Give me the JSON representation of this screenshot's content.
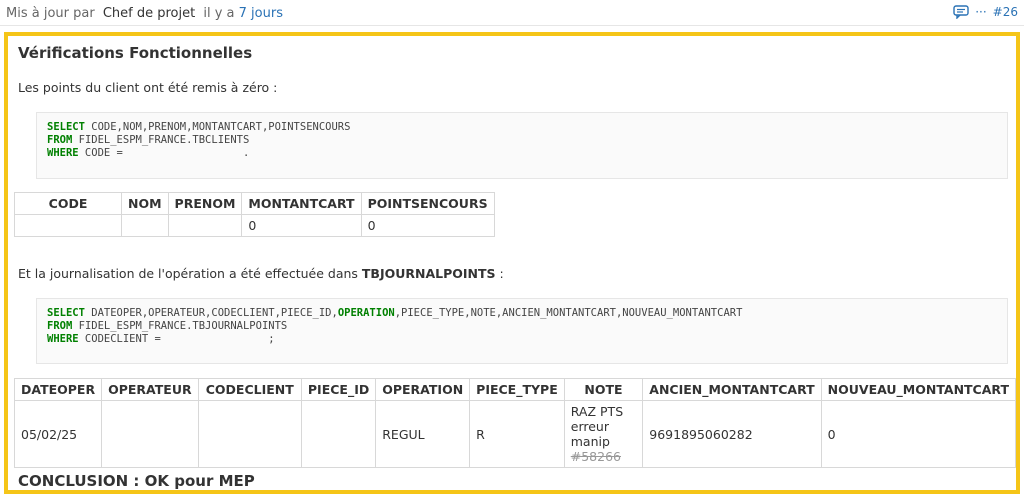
{
  "header": {
    "updated_by_label": "Mis à jour par",
    "author": "Chef de projet",
    "ago_prefix": "il y a",
    "ago_link": "7 jours",
    "more": "···",
    "note_number": "#26",
    "icons": [
      "comment-icon",
      "more-icon"
    ],
    "link_color": "#2a72b5"
  },
  "highlight_color": "#f5c518",
  "section": {
    "title": "Vérifications Fonctionnelles",
    "intro1": "Les points du client ont été remis à zéro :",
    "query1": {
      "line1_kw": "SELECT",
      "line1_rest": " CODE,NOM,PRENOM,MONTANTCART,POINTSENCOURS",
      "line2_kw": "FROM",
      "line2_rest": " FIDEL_ESPM_FRANCE.TBCLIENTS",
      "line3_kw": "WHERE",
      "line3_rest": " CODE =                   ."
    },
    "table1": {
      "headers": [
        "CODE",
        "NOM",
        "PRENOM",
        "MONTANTCART",
        "POINTSENCOURS"
      ],
      "row": [
        "",
        "",
        "",
        "0",
        "0"
      ]
    },
    "intro2_pre": "Et la journalisation de l'opération a été effectuée dans ",
    "intro2_bold": "TBJOURNALPOINTS",
    "intro2_post": " :",
    "query2": {
      "line1_kw": "SELECT",
      "line1_a": " DATEOPER,OPERATEUR,CODECLIENT,PIECE_ID,",
      "line1_kw2": "OPERATION",
      "line1_b": ",PIECE_TYPE,NOTE,ANCIEN_MONTANTCART,NOUVEAU_MONTANTCART",
      "line2_kw": "FROM",
      "line2_rest": " FIDEL_ESPM_FRANCE.TBJOURNALPOINTS",
      "line3_kw": "WHERE",
      "line3_rest": " CODECLIENT =                 ;"
    },
    "table2": {
      "headers": [
        "DATEOPER",
        "OPERATEUR",
        "CODECLIENT",
        "PIECE_ID",
        "OPERATION",
        "PIECE_TYPE",
        "NOTE",
        "ANCIEN_MONTANTCART",
        "NOUVEAU_MONTANTCART"
      ],
      "row": {
        "dateoper": "05/02/25",
        "operateur": "",
        "codeclient": "",
        "piece_id": "",
        "operation": "REGUL",
        "piece_type": "R",
        "note_line1": "RAZ PTS erreur",
        "note_line2": "manip ",
        "note_issue": "#58266",
        "ancien": "9691895060282",
        "nouveau": "0"
      }
    },
    "conclusion": "CONCLUSION : OK pour MEP"
  }
}
